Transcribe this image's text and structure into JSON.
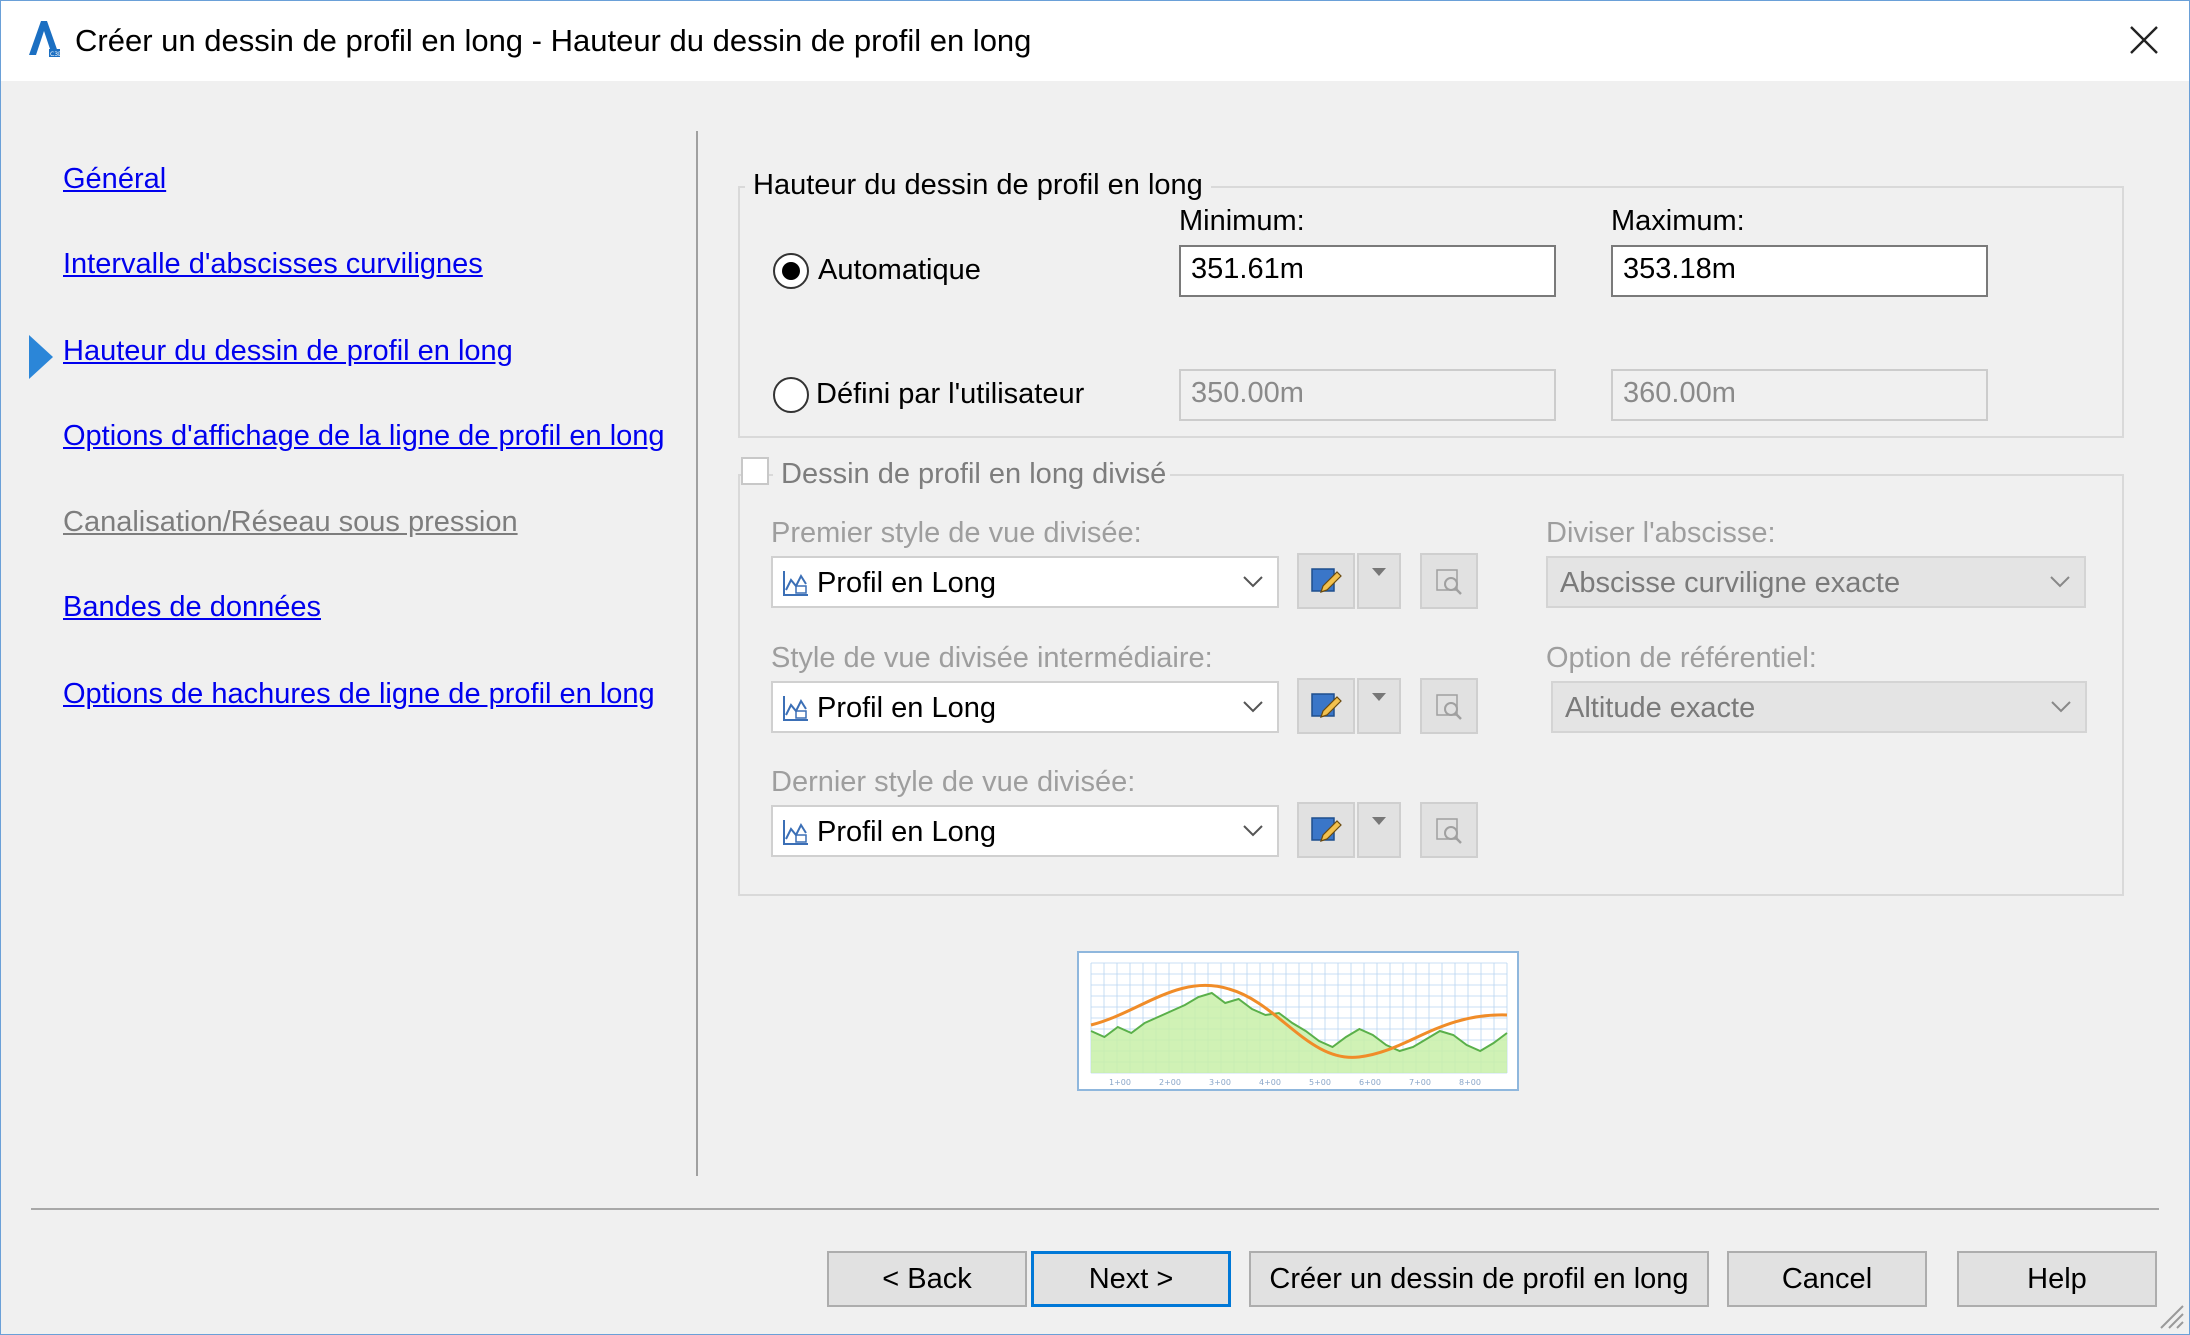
{
  "window": {
    "title": "Créer un dessin de profil en long - Hauteur du dessin de profil en long",
    "close_label": "×"
  },
  "nav": {
    "items": [
      {
        "label": "Général",
        "state": "link"
      },
      {
        "label": "Intervalle d'abscisses curvilignes",
        "state": "link"
      },
      {
        "label": "Hauteur du dessin de profil en long",
        "state": "current"
      },
      {
        "label": "Options d'affichage de la ligne de profil en long",
        "state": "link"
      },
      {
        "label": "Canalisation/Réseau sous pression",
        "state": "disabled"
      },
      {
        "label": "Bandes de données",
        "state": "link"
      },
      {
        "label": "Options de hachures de ligne de profil en long",
        "state": "link"
      }
    ],
    "current_index": 2
  },
  "height_group": {
    "title": "Hauteur du dessin de profil en long",
    "min_label": "Minimum:",
    "max_label": "Maximum:",
    "automatic": {
      "label": "Automatique",
      "selected": true,
      "min": "351.61m",
      "max": "353.18m"
    },
    "user_defined": {
      "label": "Défini par l'utilisateur",
      "selected": false,
      "min": "350.00m",
      "max": "360.00m"
    }
  },
  "split_group": {
    "title": "Dessin de profil en long divisé",
    "checked": false,
    "first_style": {
      "label": "Premier style de vue divisée:",
      "value": "Profil en Long"
    },
    "middle_style": {
      "label": "Style de vue divisée intermédiaire:",
      "value": "Profil en Long"
    },
    "last_style": {
      "label": "Dernier style de vue divisée:",
      "value": "Profil en Long"
    },
    "split_station": {
      "label": "Diviser l'abscisse:",
      "value": "Abscisse curviligne exacte"
    },
    "datum_option": {
      "label": "Option de référentiel:",
      "value": "Altitude exacte"
    }
  },
  "preview": {
    "station_labels": [
      "1+00",
      "2+00",
      "3+00",
      "4+00",
      "5+00",
      "6+00",
      "7+00",
      "8+00"
    ],
    "colors": {
      "grid": "#b8d4f0",
      "fill": "#c8f0a8",
      "ground": "#5ab04a",
      "profile": "#f08c28"
    }
  },
  "buttons": {
    "back": "< Back",
    "next": "Next >",
    "create": "Créer un dessin de profil en long",
    "cancel": "Cancel",
    "help": "Help"
  },
  "colors": {
    "link": "#0000ee",
    "accent": "#2b86d8",
    "disabled_text": "#9e9e9e"
  }
}
